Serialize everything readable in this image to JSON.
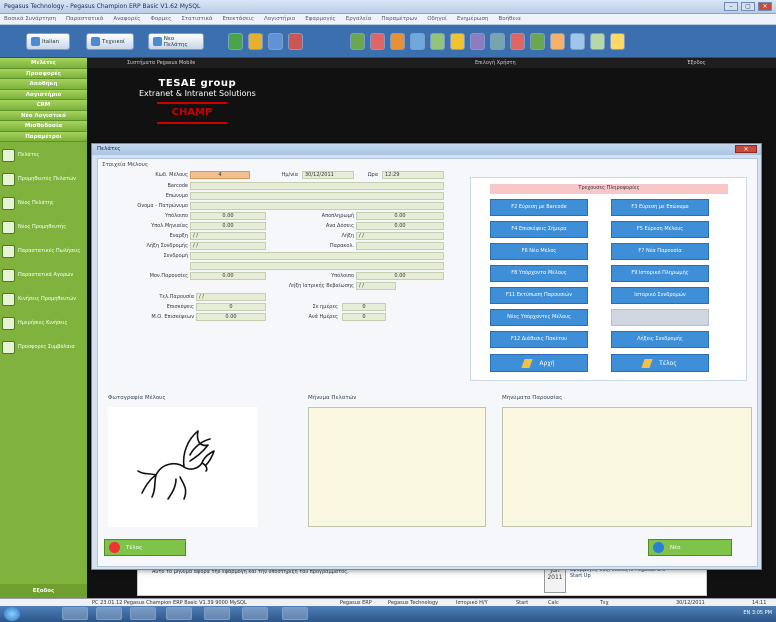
{
  "window": {
    "title": "Pegasus Technology - Pegasus Champion ERP Basic V1.62 MySQL",
    "buttons": [
      "–",
      "▢",
      "✕"
    ]
  },
  "menubar": [
    "Βασικά Συνάρτηση",
    "Παραστατικά",
    "Αναφορές",
    "Φορμες",
    "Στατιστικά",
    "Επεκτάσεις",
    "Λογιστήριο",
    "Εφαρμογές",
    "Εργαλεία",
    "Παραμέτρων",
    "Οδηγοί",
    "Ενημέρωση",
    "Βοήθεια"
  ],
  "toolbar": {
    "btn1": "Italian",
    "btn2": "Τεχνικοί",
    "btn3": "Νεο Πελάτης"
  },
  "sidebar": {
    "heads": [
      "Μελέτες",
      "Προσφορές",
      "Αποθήκη",
      "Λογιστήριο",
      "CRM",
      "Νέο Λογιστικό",
      "Μισθοδοσία",
      "Παραμέτροι"
    ],
    "items": [
      "Πελάτες",
      "Προμηθευτές Πελατών",
      "Νέος Πελάτης",
      "Νέος Προμηθευτής",
      "Παραστατικές Πωλήσεις",
      "Παραστατικά Αγορών",
      "Κινήσεις Προμηθευτών",
      "Ημερήσιες Κινήσεις",
      "Προσφορές Συμβόλαια"
    ],
    "footer": "Εξοδος"
  },
  "background": {
    "top_left": "Συστήματα Pegasus Mobile",
    "top_center": "Επιλογή Χρήστη",
    "top_right": "Έξοδος",
    "brand_line1": "TESAE group",
    "brand_line2": "Extranet & Intranet Solutions",
    "logo": "CHAMP",
    "bottom_note": "Αυτό το μήνυμα αφορά την εφαρμογή και την υποστήριξη του προγράμματος.",
    "cal_day": "14",
    "cal_month": "Jun",
    "cal_year": "2011",
    "news": "Νέα Βελτιωμένη Διεπαφή Για τις Εφαρμογές σας, επιλέξτε Pegasus ERP Start Up"
  },
  "modal": {
    "title": "Πελάτες",
    "close": "✕",
    "section_label": "Στοιχεία Μέλους",
    "form": {
      "code_label": "Κωδ. Μέλους",
      "code_value": "4",
      "date_label": "Ημ/νία",
      "date_value": "30/12/2011",
      "time_label": "Ωρα",
      "time_value": "12:29",
      "barcode_label": "Barcode",
      "surname_label": "Επώνυμο",
      "firstname_label": "Ονομα - Πατρώνυμο",
      "balance_label": "Υπόλοιπο",
      "balance_value": "0.00",
      "credit_label": "Αποπληρωμή",
      "credit_value": "0.00",
      "monthly_label": "Υπολ.Μηνιαίας",
      "monthly_value": "0.00",
      "debit_label": "Ανα Δόσεις",
      "debit_value": "0.00",
      "start_label": "Εναρξη",
      "start_value": "/ /",
      "end_label": "Λήξη",
      "end_value": "/ /",
      "renew_label": "Λήξη Συνδρομής",
      "renew_value": "/ /",
      "note_label": "Παρακολ.",
      "subscription_label": "Συνδρομή",
      "sessions_label": "Μον.Παρουσίες",
      "sessions_value": "0.00",
      "remaining_label": "Υπόλοιπο",
      "remaining_value": "0.00",
      "cert_label": "Λήξη Ιατρικής Βεβαίωσης",
      "cert_value": "/ /",
      "last_label": "Τελ.Παρουσία",
      "last_value": "/ /",
      "visits_label": "Επισκέψεις",
      "visits_value": "0",
      "days_label": "Σε ημέρες",
      "days_value": "0",
      "avg_label": "Μ.Ο. Επισκέψεων",
      "avg_value": "0.00",
      "perday_label": "Ανά Ημέρες",
      "perday_value": "0"
    },
    "ops": {
      "title": "Τρεχουσες Πληροφορίες",
      "buttons": [
        "F2 Εύρεση με Barcode",
        "F3 Εύρεση με Επώνυμο",
        "F4 Επισκέψεις Σήμερα",
        "F5 Εύρεση Μέλους",
        "F6 Νέο Μέλος",
        "F7 Νέα Παρουσία",
        "F8 Υπόρχοντα Μέλους",
        "F9 Ιστορικό Πληρωμής",
        "F11 Εκτύπωση Παρουσιών",
        "Ιστορικό Συνδρομών",
        "Νέες Υπόρχοντες Μέλους",
        "",
        "F12 Διάθεσις Πακέτου",
        "Λήξεις Συνδρομής"
      ],
      "save": "Αρχή",
      "exit": "Τέλος"
    },
    "photo_title": "Φωτογραφία Μέλους",
    "messages_title": "Μήνυμα Πελατών",
    "notes_title": "Μηνύματα Παρουσίας",
    "footer_left": "Τέλος",
    "footer_right": "Νέο"
  },
  "taskbar": {
    "status_left": "PC 23.01.12 Pegasus Champion ERP Basic V1.39 9000 MySQL",
    "status_items": [
      "Pegasus ERP",
      "Pegasus Technology",
      "Ιστορικό Η/Υ",
      "Start",
      "Calc",
      "Τεχ"
    ],
    "date": "30/12/2011",
    "time": "14:11",
    "tray": "EN 3:05 PM"
  }
}
